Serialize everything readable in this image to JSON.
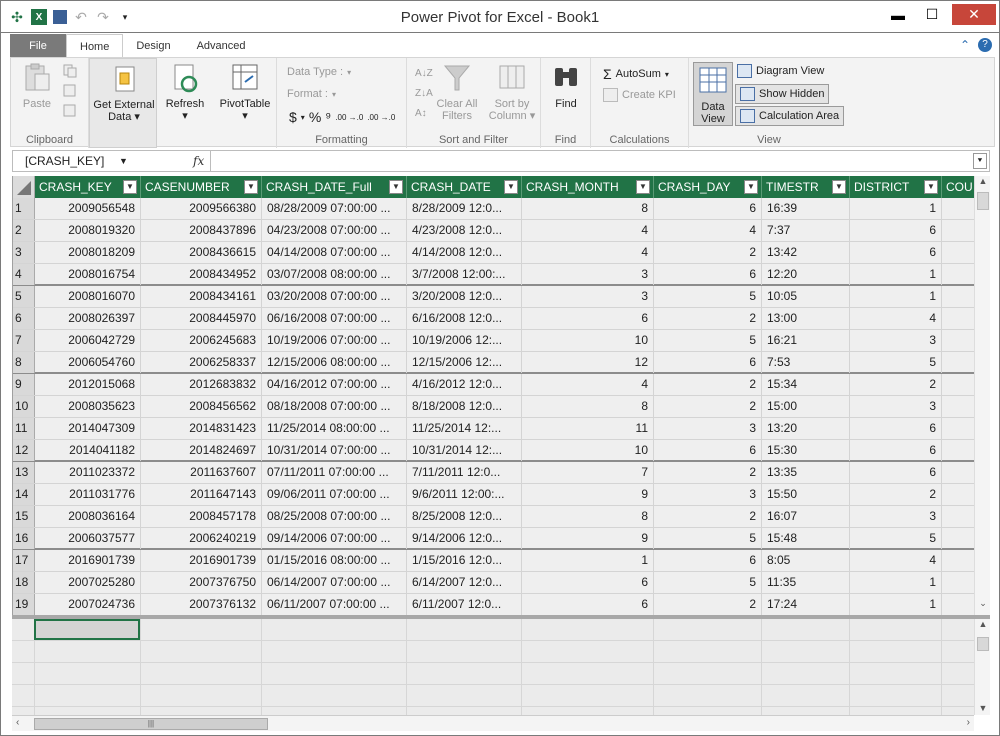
{
  "window": {
    "title": "Power Pivot for Excel - Book1",
    "min_glyph": "▬",
    "max_glyph": "☐",
    "close_glyph": "✕"
  },
  "ribbon_tabs": {
    "file": "File",
    "home": "Home",
    "design": "Design",
    "advanced": "Advanced"
  },
  "ribbon": {
    "clipboard": {
      "paste": "Paste",
      "group": "Clipboard"
    },
    "get_external_data": {
      "line1": "Get External",
      "line2": "Data"
    },
    "refresh": "Refresh",
    "pivottable": "PivotTable",
    "formatting": {
      "data_type": "Data Type :",
      "format": "Format :",
      "currency": "$",
      "percent": "%",
      "comma": "⁹",
      "inc_dec": ".00 →.0",
      "dec_dec": ".00 →.0",
      "group": "Formatting"
    },
    "sort_filter": {
      "clear_line1": "Clear All",
      "clear_line2": "Filters",
      "sort_line1": "Sort by",
      "sort_line2": "Column",
      "group": "Sort and Filter"
    },
    "find": {
      "button": "Find",
      "group": "Find"
    },
    "calculations": {
      "autosum": "AutoSum",
      "create_kpi": "Create KPI",
      "group": "Calculations"
    },
    "view": {
      "data_line1": "Data",
      "data_line2": "View",
      "diagram": "Diagram View",
      "show_hidden": "Show Hidden",
      "calc_area": "Calculation Area",
      "group": "View"
    }
  },
  "formula_bar": {
    "name_box": "[CRASH_KEY]",
    "fx": "fx",
    "formula": ""
  },
  "table": {
    "columns": [
      "CRASH_KEY",
      "CASENUMBER",
      "CRASH_DATE_Full",
      "CRASH_DATE",
      "CRASH_MONTH",
      "CRASH_DAY",
      "TIMESTR",
      "DISTRICT",
      "COU"
    ],
    "rows": [
      [
        "1",
        "2009056548",
        "2009566380",
        "08/28/2009 07:00:00 ...",
        "8/28/2009 12:0...",
        "8",
        "6",
        "16:39",
        "1"
      ],
      [
        "2",
        "2008019320",
        "2008437896",
        "04/23/2008 07:00:00 ...",
        "4/23/2008 12:0...",
        "4",
        "4",
        "7:37",
        "6"
      ],
      [
        "3",
        "2008018209",
        "2008436615",
        "04/14/2008 07:00:00 ...",
        "4/14/2008 12:0...",
        "4",
        "2",
        "13:42",
        "6"
      ],
      [
        "4",
        "2008016754",
        "2008434952",
        "03/07/2008 08:00:00 ...",
        "3/7/2008 12:00:...",
        "3",
        "6",
        "12:20",
        "1"
      ],
      [
        "5",
        "2008016070",
        "2008434161",
        "03/20/2008 07:00:00 ...",
        "3/20/2008 12:0...",
        "3",
        "5",
        "10:05",
        "1"
      ],
      [
        "6",
        "2008026397",
        "2008445970",
        "06/16/2008 07:00:00 ...",
        "6/16/2008 12:0...",
        "6",
        "2",
        "13:00",
        "4"
      ],
      [
        "7",
        "2006042729",
        "2006245683",
        "10/19/2006 07:00:00 ...",
        "10/19/2006 12:...",
        "10",
        "5",
        "16:21",
        "3"
      ],
      [
        "8",
        "2006054760",
        "2006258337",
        "12/15/2006 08:00:00 ...",
        "12/15/2006 12:...",
        "12",
        "6",
        "7:53",
        "5"
      ],
      [
        "9",
        "2012015068",
        "2012683832",
        "04/16/2012 07:00:00 ...",
        "4/16/2012 12:0...",
        "4",
        "2",
        "15:34",
        "2"
      ],
      [
        "10",
        "2008035623",
        "2008456562",
        "08/18/2008 07:00:00 ...",
        "8/18/2008 12:0...",
        "8",
        "2",
        "15:00",
        "3"
      ],
      [
        "11",
        "2014047309",
        "2014831423",
        "11/25/2014 08:00:00 ...",
        "11/25/2014 12:...",
        "11",
        "3",
        "13:20",
        "6"
      ],
      [
        "12",
        "2014041182",
        "2014824697",
        "10/31/2014 07:00:00 ...",
        "10/31/2014 12:...",
        "10",
        "6",
        "15:30",
        "6"
      ],
      [
        "13",
        "2011023372",
        "2011637607",
        "07/11/2011 07:00:00 ...",
        "7/11/2011 12:0...",
        "7",
        "2",
        "13:35",
        "6"
      ],
      [
        "14",
        "2011031776",
        "2011647143",
        "09/06/2011 07:00:00 ...",
        "9/6/2011 12:00:...",
        "9",
        "3",
        "15:50",
        "2"
      ],
      [
        "15",
        "2008036164",
        "2008457178",
        "08/25/2008 07:00:00 ...",
        "8/25/2008 12:0...",
        "8",
        "2",
        "16:07",
        "3"
      ],
      [
        "16",
        "2006037577",
        "2006240219",
        "09/14/2006 07:00:00 ...",
        "9/14/2006 12:0...",
        "9",
        "5",
        "15:48",
        "5"
      ],
      [
        "17",
        "2016901739",
        "2016901739",
        "01/15/2016 08:00:00 ...",
        "1/15/2016 12:0...",
        "1",
        "6",
        "8:05",
        "4"
      ],
      [
        "18",
        "2007025280",
        "2007376750",
        "06/14/2007 07:00:00 ...",
        "6/14/2007 12:0...",
        "6",
        "5",
        "11:35",
        "1"
      ],
      [
        "19",
        "2007024736",
        "2007376132",
        "06/11/2007 07:00:00 ...",
        "6/11/2007 12:0...",
        "6",
        "2",
        "17:24",
        "1"
      ]
    ]
  },
  "colors": {
    "header_green": "#217346",
    "ribbon_bg": "#f3f3f3",
    "file_tab": "#7a7a7a"
  }
}
